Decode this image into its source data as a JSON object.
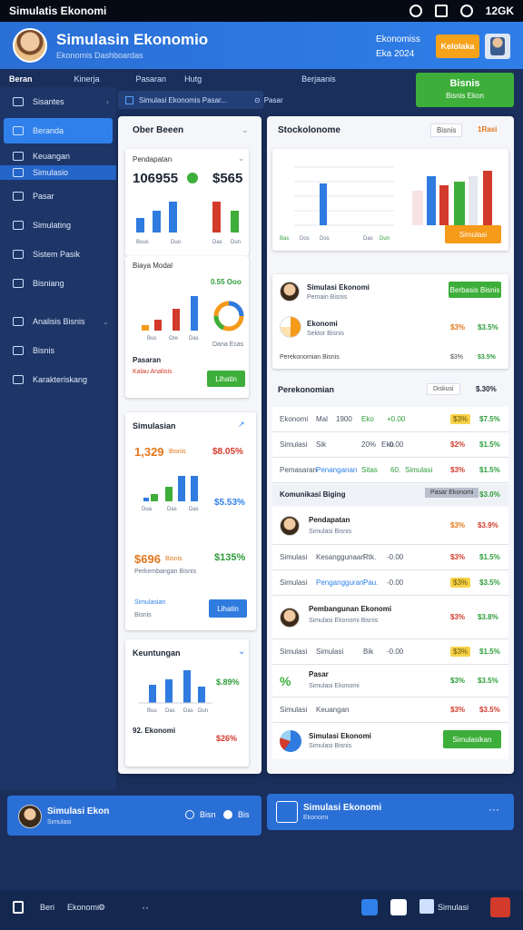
{
  "status": {
    "title": "Simulatis Ekonomi",
    "time": "12GK"
  },
  "header": {
    "title": "Simulasin Ekonomio",
    "subtitle": "Ekonomis Dashboardas",
    "meta1": "Ekonomiss",
    "meta2": "Eka  2024",
    "button": "Kelolaka",
    "colors": {
      "accent": "#2f80ea",
      "green": "#3dae3a",
      "orange": "#f59a19",
      "red": "#d23a2b"
    }
  },
  "topnav": [
    "Beran",
    "Kinerja",
    "Pasaran",
    "Hutg",
    "Berjaanis"
  ],
  "cta": {
    "label": "Bisnis",
    "sub": "Bisnis Ekon"
  },
  "sidebar": [
    {
      "label": "Sisantes",
      "icon": "menu-icon"
    },
    {
      "label": "Beranda",
      "icon": "home-icon"
    },
    {
      "label": "Keuangan",
      "icon": "wallet-icon"
    },
    {
      "label": "Simulasio",
      "icon": "chart-icon"
    },
    {
      "label": "Pasar",
      "icon": "market-icon"
    },
    {
      "label": "Simulating",
      "icon": "sim-icon"
    },
    {
      "label": "Sistem Pasik",
      "icon": "gear-icon"
    },
    {
      "label": "Bisniang",
      "icon": "briefcase-icon"
    },
    {
      "label": "Analisis Bisnis",
      "icon": "analytics-icon"
    },
    {
      "label": "Bisnis",
      "icon": "store-icon"
    },
    {
      "label": "Karakteriskang",
      "icon": "people-icon"
    }
  ],
  "search": {
    "placeholder": "Simulasi Ekonomis Pasar...",
    "right": "Pasar"
  },
  "left_panel": {
    "title": "Ober Beeen",
    "card1": {
      "label": "Pendapatan",
      "value1": "106955",
      "value2": "$565",
      "x": [
        "Buus",
        "Duo",
        "Das",
        "Dun"
      ]
    },
    "card2": {
      "label": "Biaya Modal",
      "tag": "0.55 Ooo",
      "x": [
        "Bus",
        "Ore",
        "Das"
      ],
      "donut_label": "Dana Ecas",
      "footer": "Pasaran",
      "footer2": "Kalau Analisis",
      "button": "Lihatin"
    },
    "card3": {
      "label": "Simulasian",
      "v1": "1,329",
      "v1b": "Bisnis",
      "p1": "$8.05%",
      "p2": "$5.53%",
      "v2": "$696",
      "v2b": "Bisnis",
      "p3": "$135%",
      "sub": "Perkembangan Bisnis",
      "link": "Simulasian",
      "link2": "Bisnis",
      "button": "Lihatin",
      "x": [
        "Dua",
        "Das",
        "Das"
      ]
    },
    "card4": {
      "label": "Keuntungan",
      "p1": "$.89%",
      "v": "92.  Ekonomi",
      "p2": "$26%",
      "x": [
        "Buu",
        "Das",
        "Das",
        "Dun"
      ]
    }
  },
  "right_panel": {
    "title": "Stockolonome",
    "chip1": "Bisnis",
    "chip2": "1Rasi",
    "chart_card": {
      "x": [
        "Bas",
        "Dos",
        "Dos",
        "Das",
        "Dun"
      ],
      "button": "Simulasi"
    },
    "person1": {
      "name": "Simulasi Ekonomi",
      "role": "Pemain Bisnis",
      "button": "Berbasis Bisnis"
    },
    "person2": {
      "name": "Ekonomi",
      "role": "Sektor Bisnis",
      "p1": "$3%",
      "p2": "$3.5%"
    },
    "summary_row": {
      "label": "Perekonomian Bisnis",
      "v1": "$3%",
      "v2": "$3.5%"
    },
    "section2": {
      "title": "Perekonomian",
      "chip1": "Diskusi",
      "chip2": "$.30%"
    },
    "rows": [
      {
        "a": "Ekonomi",
        "b": "Mal",
        "c": "1900",
        "d": "Eko",
        "e": "+0.00",
        "f": "$3%",
        "g": "$7.5%"
      },
      {
        "a": "Simulasi",
        "b": "Sik",
        "c": "20%",
        "d": "Eko",
        "e": "-0.00",
        "f": "$2%",
        "g": "$1.5%"
      },
      {
        "a": "Pemasaran",
        "b": "Penanganan",
        "c": "Sitas",
        "d": "60.",
        "e": "Simulasi",
        "f": "$3%",
        "g": "$1.5%"
      }
    ],
    "section3": {
      "title": "Komunikasi Biging",
      "chip1": "Pasar Ekonomi",
      "chip2": "$3.0%"
    },
    "person3": {
      "name": "Pendapatan",
      "role": "Simulasi Bisnis",
      "p1": "$3%",
      "p2": "$3.9%"
    },
    "rows2": [
      {
        "a": "Simulasi",
        "b": "Kesanggunaan",
        "c": "Rtk.",
        "d": "-0.00",
        "f": "$3%",
        "g": "$1.5%"
      },
      {
        "a": "Simulasi",
        "b": "Pengangguran",
        "c": "Pau.",
        "d": "-0.00",
        "f": "$3%",
        "g": "$3.5%"
      }
    ],
    "person4": {
      "name": "Pembangunan Ekonomi",
      "role": "Simulasi Ekonomi  Bisnis",
      "p1": "$3%",
      "p2": "$3.8%"
    },
    "rows3": [
      {
        "a": "Simulasi",
        "b": "Simulasi",
        "c": "Bik",
        "d": "-0.00",
        "f": "$3%",
        "g": "$1.5%"
      }
    ],
    "person5": {
      "name": "Pasar",
      "role": "Simulasi Ekonomi",
      "p1": "$3%",
      "p2": "$3.5%"
    },
    "rows4": [
      {
        "a": "Simulasi",
        "b": "Keuangan",
        "f": "$3%",
        "g": "$3.5%"
      }
    ],
    "person6": {
      "name": "Simulasi Ekonomi",
      "role": "Simulasi Bisnis",
      "button": "Simulasikan"
    }
  },
  "bottom": {
    "left": {
      "name": "Simulasi Ekon",
      "sub": "Simulasi",
      "a": "Bisn",
      "b": "Bis"
    },
    "right": {
      "name": "Simulasi Ekonomi",
      "sub": "Ekonomi"
    }
  },
  "footer": {
    "a": "Beri",
    "b": "Ekonomi",
    "c": "Simulasi"
  }
}
